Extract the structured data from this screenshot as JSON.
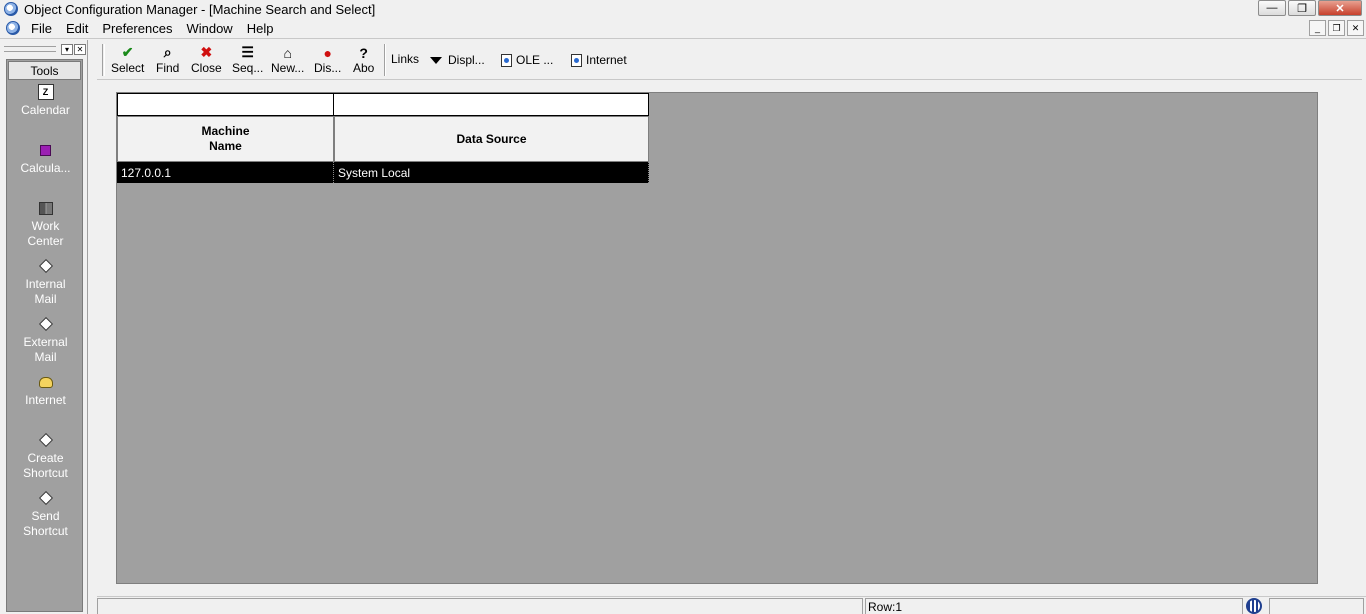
{
  "window": {
    "title": "Object Configuration Manager - [Machine Search and Select]",
    "controls": [
      "—",
      "❐",
      "✕"
    ]
  },
  "menu": {
    "items": [
      "File",
      "Edit",
      "Preferences",
      "Window",
      "Help"
    ],
    "mdi_controls": [
      "_",
      "❐",
      "✕"
    ]
  },
  "tools": {
    "label": "Tools",
    "header_controls": [
      "▾",
      "✕"
    ],
    "items": [
      {
        "line1": "Calendar",
        "line2": "",
        "icon": "calendar-icon"
      },
      {
        "line1": "Calcula...",
        "line2": "",
        "icon": "calculator-icon"
      },
      {
        "line1": "Work",
        "line2": "Center",
        "icon": "work-center-icon"
      },
      {
        "line1": "Internal",
        "line2": "Mail",
        "icon": "internal-mail-icon"
      },
      {
        "line1": "External",
        "line2": "Mail",
        "icon": "external-mail-icon"
      },
      {
        "line1": "Internet",
        "line2": "",
        "icon": "internet-icon"
      },
      {
        "line1": "Create",
        "line2": "Shortcut",
        "icon": "create-shortcut-icon"
      },
      {
        "line1": "Send",
        "line2": "Shortcut",
        "icon": "send-shortcut-icon"
      }
    ]
  },
  "toolbar": {
    "buttons": [
      {
        "label": "Select",
        "glyph": "✔",
        "color": "#1a8a1a",
        "icon": "checkmark-icon"
      },
      {
        "label": "Find",
        "glyph": "⌕",
        "color": "#000000",
        "icon": "find-icon"
      },
      {
        "label": "Close",
        "glyph": "✖",
        "color": "#d01010",
        "icon": "close-icon"
      },
      {
        "label": "Seq...",
        "glyph": "☰",
        "color": "#000000",
        "icon": "sequence-icon"
      },
      {
        "label": "New...",
        "glyph": "⌂",
        "color": "#000000",
        "icon": "new-icon"
      },
      {
        "label": "Dis...",
        "glyph": "●",
        "color": "#d01010",
        "icon": "display-icon"
      },
      {
        "label": "Abo",
        "glyph": "?",
        "color": "#000000",
        "icon": "about-icon"
      }
    ],
    "links_label": "Links",
    "display_label": "Displ...",
    "ole_label": "OLE ...",
    "internet_label": "Internet"
  },
  "grid": {
    "columns": [
      {
        "line1": "Machine",
        "line2": "Name"
      },
      {
        "line1": "Data Source",
        "line2": ""
      }
    ],
    "rows": [
      {
        "machine_name": "127.0.0.1",
        "data_source": "System Local"
      }
    ],
    "selected_row_color": "#000000",
    "background_color": "#a0a0a0"
  },
  "status": {
    "row_text": "Row:1"
  }
}
